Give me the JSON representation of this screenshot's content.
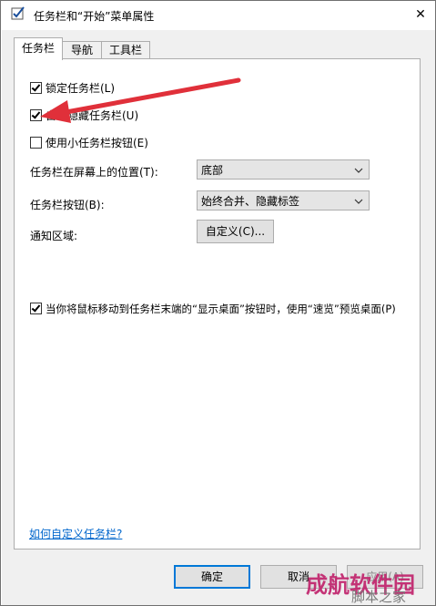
{
  "window": {
    "title": "任务栏和“开始”菜单属性",
    "close_glyph": "✕"
  },
  "tabs": [
    {
      "label": "任务栏"
    },
    {
      "label": "导航"
    },
    {
      "label": "工具栏"
    }
  ],
  "options": {
    "lock_taskbar": {
      "label": "锁定任务栏(L)",
      "checked": true
    },
    "auto_hide": {
      "label": "自动隐藏任务栏(U)",
      "checked": true
    },
    "small_buttons": {
      "label": "使用小任务栏按钮(E)",
      "checked": false
    }
  },
  "position": {
    "label": "任务栏在屏幕上的位置(T):",
    "value": "底部"
  },
  "buttons_setting": {
    "label": "任务栏按钮(B):",
    "value": "始终合并、隐藏标签"
  },
  "notification": {
    "label": "通知区域:",
    "button": "自定义(C)..."
  },
  "peek": {
    "label": "当你将鼠标移动到任务栏末端的“显示桌面”按钮时，使用“速览”预览桌面(P)",
    "checked": true
  },
  "help_link": "如何自定义任务栏?",
  "footer": {
    "ok": "确定",
    "cancel": "取消",
    "apply": "应用(A)"
  },
  "watermarks": [
    "成航软件园",
    "脚本之家"
  ],
  "colors": {
    "arrow": "#e0303a",
    "link": "#0066cc",
    "default_border": "#0078d7"
  }
}
